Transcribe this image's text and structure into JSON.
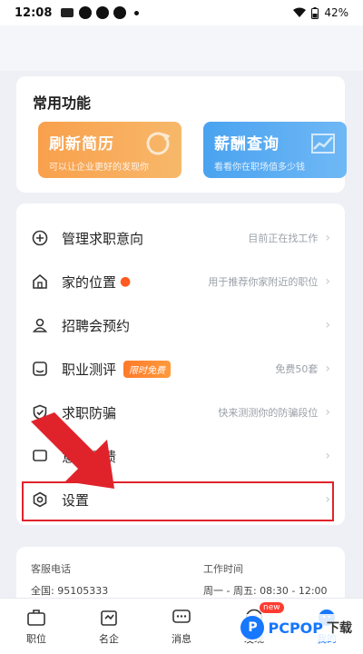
{
  "status": {
    "time": "12:08",
    "battery": "42%"
  },
  "common_functions": {
    "title": "常用功能",
    "tiles": [
      {
        "title": "刷新简历",
        "subtitle": "可以让企业更好的发现你"
      },
      {
        "title": "薪酬查询",
        "subtitle": "看看你在职场值多少钱"
      }
    ]
  },
  "menu": {
    "items": [
      {
        "label": "管理求职意向",
        "hint": "目前正在找工作"
      },
      {
        "label": "家的位置",
        "hint": "用于推荐你家附近的职位"
      },
      {
        "label": "招聘会预约",
        "hint": ""
      },
      {
        "label": "职业测评",
        "badge": "限时免费",
        "hint": "免费50套"
      },
      {
        "label": "求职防骗",
        "hint": "快来测测你的防骗段位"
      },
      {
        "label": "意见反馈",
        "hint": ""
      },
      {
        "label": "设置",
        "hint": ""
      }
    ]
  },
  "service": {
    "phone_label": "客服电话",
    "phone_value": "全国: 95105333",
    "hours_label": "工作时间",
    "hours_value": "周一 - 周五: 08:30 - 12:00"
  },
  "tabbar": {
    "tabs": [
      {
        "label": "职位"
      },
      {
        "label": "名企"
      },
      {
        "label": "消息"
      },
      {
        "label": "发现",
        "badge": "new"
      },
      {
        "label": "我的"
      }
    ]
  },
  "watermark": {
    "text1": "PCPOP",
    "text2": "下载"
  },
  "colors": {
    "accent": "#1677ff",
    "highlight": "#e0232b",
    "orange": "#f9a04c",
    "blue": "#4aa3f0"
  }
}
